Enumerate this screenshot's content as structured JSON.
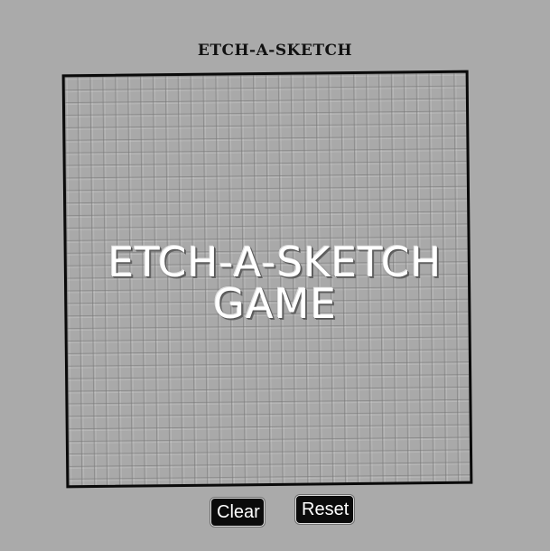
{
  "header": {
    "title": "ETCH-A-SKETCH"
  },
  "board": {
    "overlay_line1": "ETCH-A-SKETCH",
    "overlay_line2": "GAME",
    "background_color": "#a9a9a9",
    "border_color": "#0a0a0a"
  },
  "controls": {
    "clear_label": "Clear",
    "reset_label": "Reset",
    "button_color": "#0b0b0b"
  }
}
